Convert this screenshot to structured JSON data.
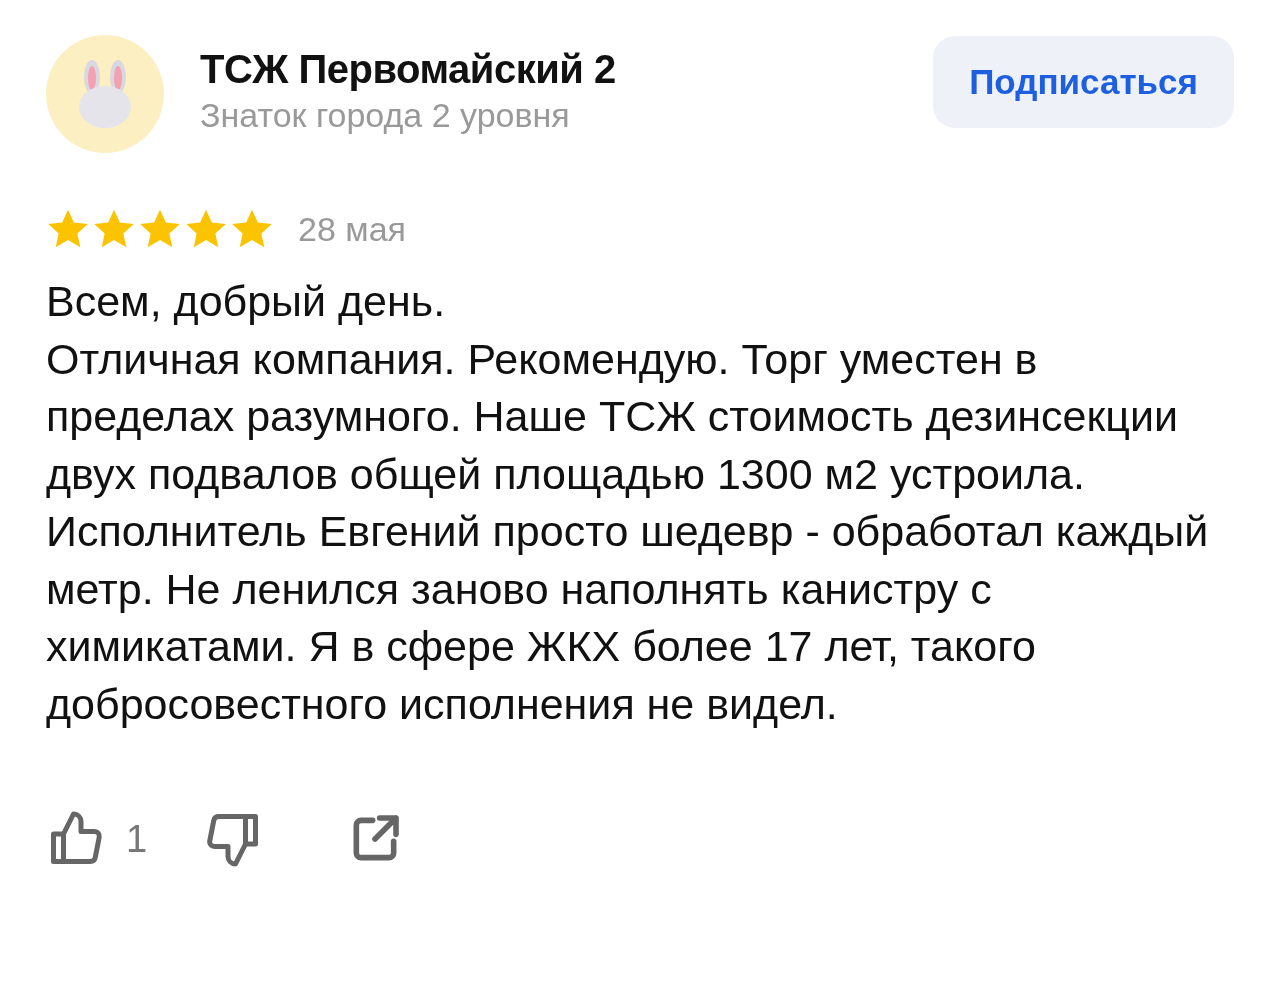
{
  "author": {
    "name": "ТСЖ Первомайский 2",
    "level": "Знаток города 2 уровня"
  },
  "subscribe_button": {
    "label": "Подписаться"
  },
  "review": {
    "stars": 5,
    "date": "28 мая",
    "paragraphs": [
      "Всем, добрый день.",
      "Отличная компания. Рекомендую. Торг уместен в пределах разумного. Наше ТСЖ стоимость дезинсекции двух подвалов общей площадью 1300 м2 устроила. Исполнитель Евгений просто шедевр - обработал каждый метр. Не ленился заново наполнять канистру с химикатами. Я в сфере ЖКХ более 17 лет, такого добросовестного исполнения не видел."
    ]
  },
  "actions": {
    "likes": "1"
  }
}
